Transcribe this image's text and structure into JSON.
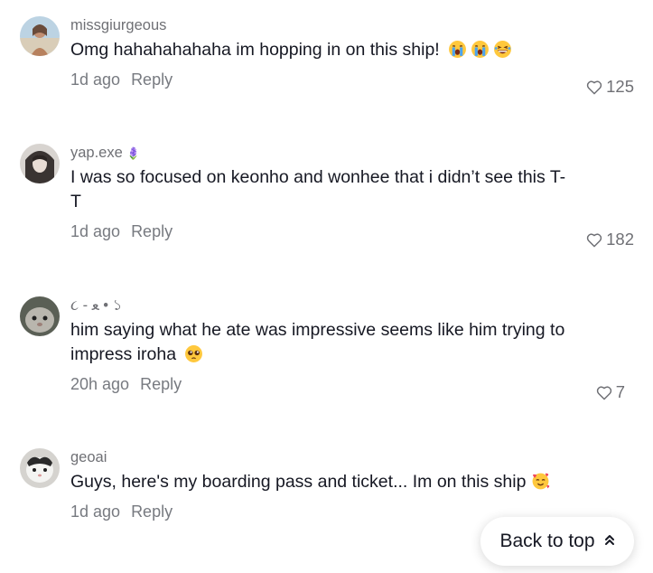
{
  "comments": [
    {
      "username": "missgiurgeous",
      "text": "Omg hahahahahaha im hopping in on this ship!",
      "emojis": [
        "crying-face",
        "crying-face",
        "laughing-face"
      ],
      "time": "1d ago",
      "reply": "Reply",
      "likes": "125"
    },
    {
      "username": "yap.exe",
      "username_suffix": "🪻",
      "text": "I was so focused on keonho and wonhee that i didn’t see this T-T",
      "time": "1d ago",
      "reply": "Reply",
      "likes": "182"
    },
    {
      "username": "૮ - ﻌ • ১",
      "text": "him saying what he ate was impressive seems like him trying to impress iroha",
      "emojis": [
        "pleading-face"
      ],
      "time": "20h ago",
      "reply": "Reply",
      "likes": "7"
    },
    {
      "username": "geoai",
      "text": "Guys, here's my boarding pass and ticket... Im on this ship",
      "emojis": [
        "smiling-face-with-hearts"
      ],
      "time": "1d ago",
      "reply": "Reply"
    }
  ],
  "back_to_top": "Back to top",
  "colors": {
    "text_primary": "#161823",
    "text_secondary": "#777a80",
    "background": "#ffffff"
  }
}
